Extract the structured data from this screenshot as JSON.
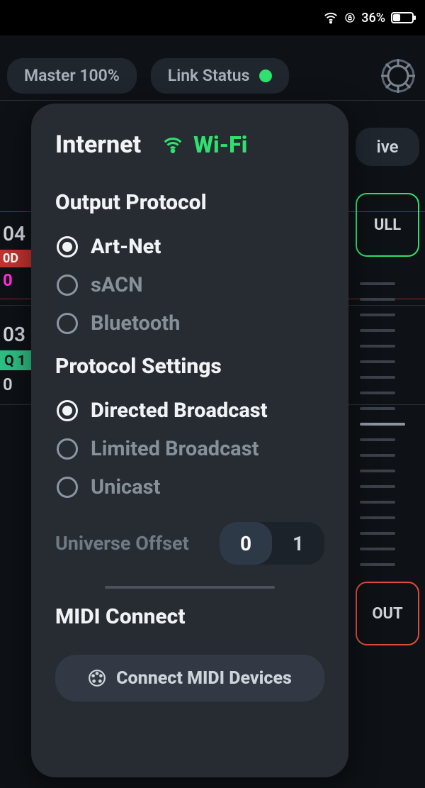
{
  "status_bar": {
    "battery_pct": "36%"
  },
  "header": {
    "master_label": "Master 100%",
    "link_status_label": "Link Status",
    "live_label": "ive"
  },
  "bg": {
    "num1": "04",
    "tag_red": "0D",
    "zero_m": "0",
    "num2": "03",
    "tag_g": "Q 1",
    "zero2": "0",
    "full_label": "ULL",
    "out_label": "OUT"
  },
  "panel": {
    "title": "Internet",
    "wifi_label": "Wi-Fi",
    "sections": {
      "output_protocol": {
        "title": "Output Protocol",
        "options": [
          {
            "label": "Art-Net",
            "selected": true
          },
          {
            "label": "sACN",
            "selected": false
          },
          {
            "label": "Bluetooth",
            "selected": false
          }
        ]
      },
      "protocol_settings": {
        "title": "Protocol Settings",
        "options": [
          {
            "label": "Directed Broadcast",
            "selected": true
          },
          {
            "label": "Limited Broadcast",
            "selected": false
          },
          {
            "label": "Unicast",
            "selected": false
          }
        ]
      },
      "universe_offset": {
        "label": "Universe Offset",
        "options": [
          "0",
          "1"
        ],
        "selected": "0"
      },
      "midi": {
        "title": "MIDI Connect",
        "button": "Connect MIDI Devices"
      }
    }
  }
}
